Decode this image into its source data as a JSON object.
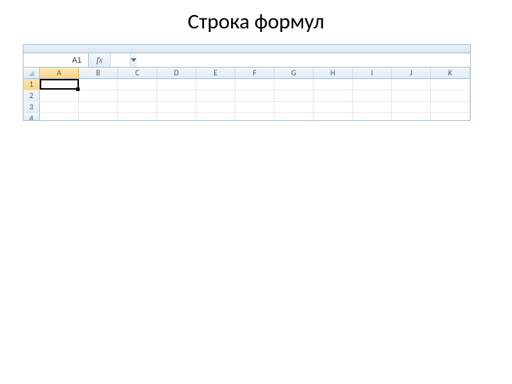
{
  "slide": {
    "title": "Строка формул"
  },
  "formula_bar": {
    "name_box_value": "A1",
    "fx_label": "fx",
    "formula_value": ""
  },
  "grid": {
    "columns": [
      "A",
      "B",
      "C",
      "D",
      "E",
      "F",
      "G",
      "H",
      "I",
      "J",
      "K"
    ],
    "rows": [
      "1",
      "2",
      "3",
      "4"
    ],
    "active_cell": "A1",
    "active_col": "A",
    "active_row": "1"
  }
}
